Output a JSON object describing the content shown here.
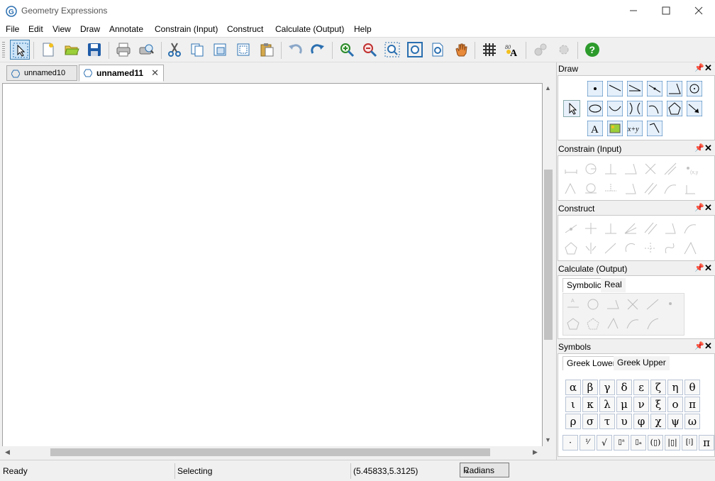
{
  "window": {
    "title": "Geometry Expressions"
  },
  "menu": [
    "File",
    "Edit",
    "View",
    "Draw",
    "Annotate",
    "Constrain (Input)",
    "Construct",
    "Calculate (Output)",
    "Help"
  ],
  "tabs": [
    "unnamed10",
    "unnamed11"
  ],
  "panels": {
    "draw": "Draw",
    "constrain": "Constrain (Input)",
    "construct": "Construct",
    "calculate": "Calculate (Output)",
    "symbols": "Symbols"
  },
  "calculate_tabs": [
    "Symbolic",
    "Real"
  ],
  "symbol_tabs": [
    "Greek Lower",
    "Greek Upper"
  ],
  "greek_lower": [
    "α",
    "β",
    "γ",
    "δ",
    "ε",
    "ζ",
    "η",
    "θ",
    "ι",
    "κ",
    "λ",
    "μ",
    "ν",
    "ξ",
    "ο",
    "π",
    "ρ",
    "σ",
    "τ",
    "υ",
    "φ",
    "χ",
    "ψ",
    "ω"
  ],
  "status": {
    "state": "Ready",
    "mode": "Selecting",
    "coords": "(5.45833,5.3125)",
    "units": "Radians"
  },
  "colors": {
    "accent_blue": "#2a6fb0",
    "help_green": "#2c9b2c",
    "tab_border": "#aaaaaa"
  },
  "icons": {
    "toolbar": [
      "select-arrow-icon",
      "new-file-icon",
      "open-folder-icon",
      "save-icon",
      "print-icon",
      "print-preview-icon",
      "cut-icon",
      "copy-icon",
      "copy-special-icon",
      "paste-special-icon",
      "paste-icon",
      "undo-icon",
      "redo-icon",
      "zoom-in-icon",
      "zoom-out-icon",
      "zoom-window-icon",
      "zoom-fit-icon",
      "zoom-page-icon",
      "pan-hand-icon",
      "grid-icon",
      "text-format-icon",
      "settings-gear-icon",
      "settings-gear-2-icon",
      "help-icon"
    ]
  }
}
